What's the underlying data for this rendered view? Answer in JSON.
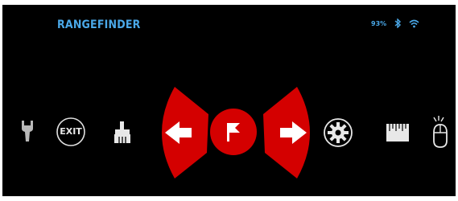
{
  "header": {
    "title": "RANGEFINDER",
    "battery": "93%",
    "bluetooth_icon": "bluetooth-icon",
    "wifi_icon": "wifi-icon"
  },
  "menu": {
    "items": [
      {
        "name": "tools-icon",
        "label": ""
      },
      {
        "name": "exit-button",
        "label": "EXIT"
      },
      {
        "name": "clean-brush-icon",
        "label": ""
      },
      {
        "name": "left-arrow-button",
        "label": ""
      },
      {
        "name": "rangefinder-flag-button",
        "label": ""
      },
      {
        "name": "right-arrow-button",
        "label": ""
      },
      {
        "name": "settings-gear-icon",
        "label": ""
      },
      {
        "name": "ruler-icon",
        "label": ""
      },
      {
        "name": "mouse-icon",
        "label": ""
      }
    ]
  },
  "colors": {
    "accent_red": "#d40000",
    "title_blue": "#4aa8e8",
    "background": "#000000",
    "icon": "#e8e8e8"
  }
}
